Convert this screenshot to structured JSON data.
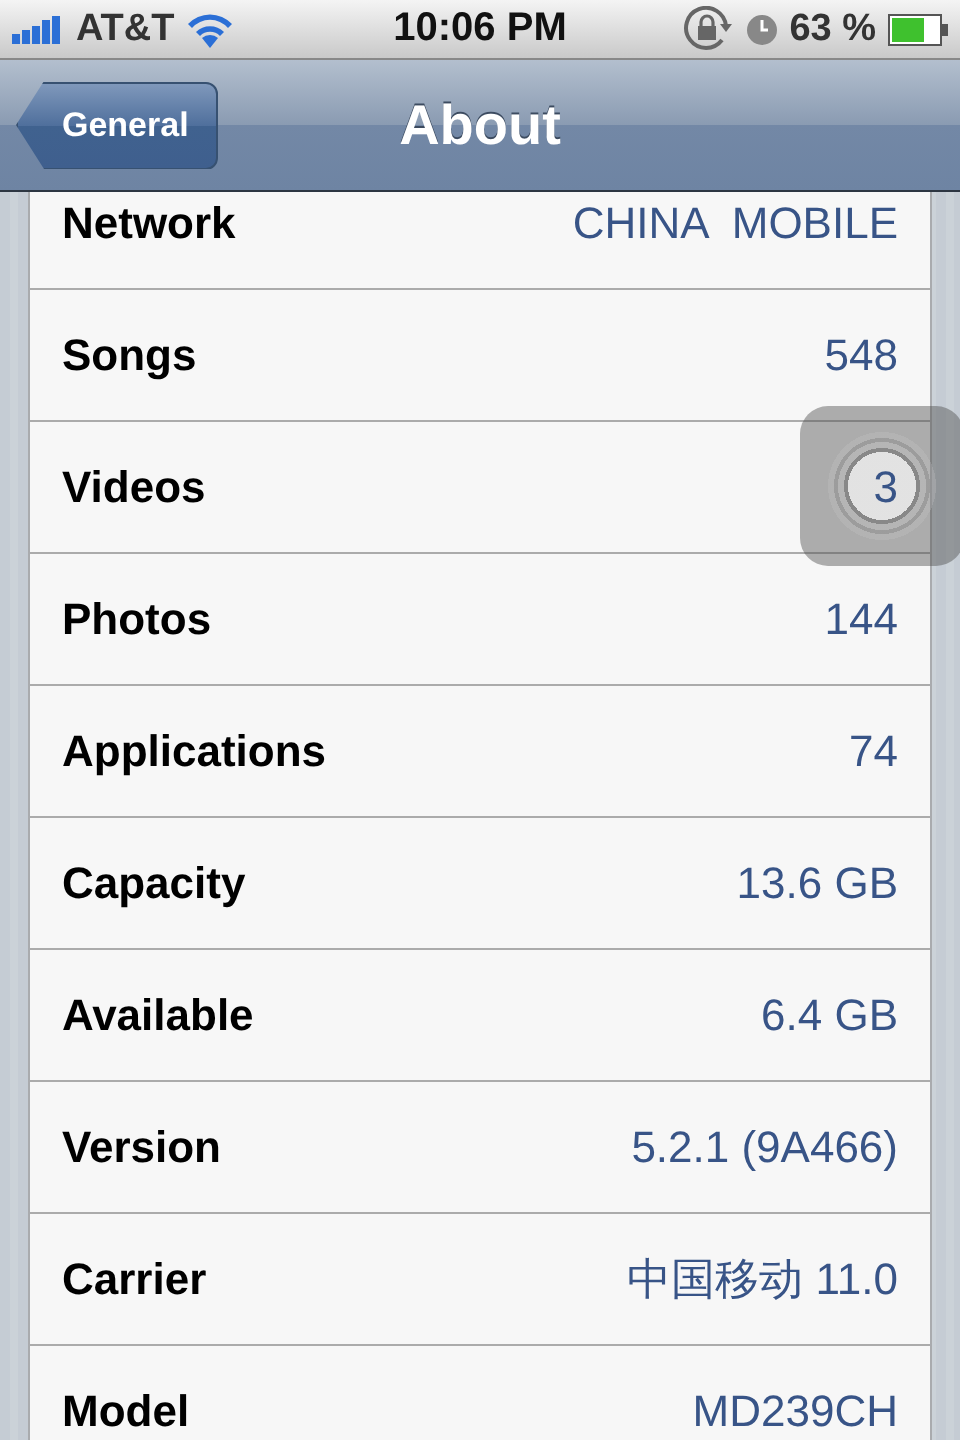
{
  "status_bar": {
    "carrier": "AT&T",
    "time": "10:06 PM",
    "battery": "63 %"
  },
  "nav_bar": {
    "back": "General",
    "title": "About"
  },
  "rows": [
    {
      "label": "Network",
      "value": "CHINA  MOBILE"
    },
    {
      "label": "Songs",
      "value": "548"
    },
    {
      "label": "Videos",
      "value": "3"
    },
    {
      "label": "Photos",
      "value": "144"
    },
    {
      "label": "Applications",
      "value": "74"
    },
    {
      "label": "Capacity",
      "value": "13.6 GB"
    },
    {
      "label": "Available",
      "value": "6.4 GB"
    },
    {
      "label": "Version",
      "value": "5.2.1 (9A466)"
    },
    {
      "label": "Carrier",
      "value": "中国移动 11.0"
    },
    {
      "label": "Model",
      "value": "MD239CH"
    }
  ]
}
